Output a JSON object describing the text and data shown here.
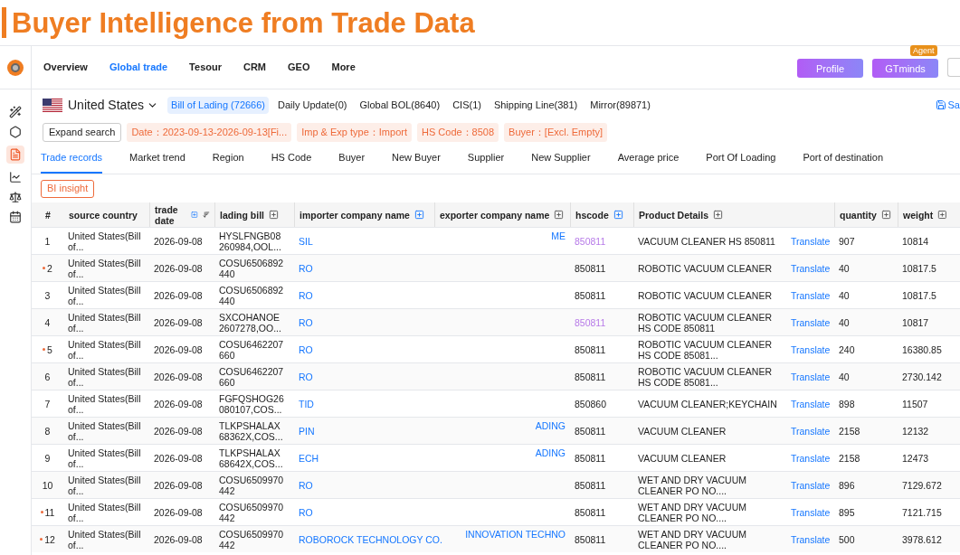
{
  "banner": {
    "title": "Buyer Intelligence from Trade Data"
  },
  "nav": {
    "items": [
      {
        "label": "Overview",
        "selected": false
      },
      {
        "label": "Global trade",
        "selected": true
      },
      {
        "label": "Tesour",
        "selected": false
      },
      {
        "label": "CRM",
        "selected": false
      },
      {
        "label": "GEO",
        "selected": false
      },
      {
        "label": "More",
        "selected": false
      }
    ],
    "buttons": [
      {
        "label": "Profile"
      },
      {
        "label": "GTminds",
        "badge": "Agent"
      }
    ]
  },
  "country": "United States",
  "sources": [
    {
      "label": "Bill of Lading (72666)",
      "selected": true
    },
    {
      "label": "Daily Update(0)",
      "selected": false
    },
    {
      "label": "Global BOL(8640)",
      "selected": false
    },
    {
      "label": "CIS(1)",
      "selected": false
    },
    {
      "label": "Shipping Line(381)",
      "selected": false
    },
    {
      "label": "Mirror(89871)",
      "selected": false
    }
  ],
  "save_link": "Sa",
  "expand_search": "Expand search",
  "filters": [
    "Date：2023-09-13-2026-09-13[Fi...",
    "Imp & Exp type：Import",
    "HS Code：8508",
    "Buyer：[Excl. Empty]"
  ],
  "tabs": [
    {
      "label": "Trade records",
      "selected": true
    },
    {
      "label": "Market trend",
      "selected": false
    },
    {
      "label": "Region",
      "selected": false
    },
    {
      "label": "HS Code",
      "selected": false
    },
    {
      "label": "Buyer",
      "selected": false
    },
    {
      "label": "New Buyer",
      "selected": false
    },
    {
      "label": "Supplier",
      "selected": false
    },
    {
      "label": "New Supplier",
      "selected": false
    },
    {
      "label": "Average price",
      "selected": false
    },
    {
      "label": "Port Of Loading",
      "selected": false
    },
    {
      "label": "Port of destination",
      "selected": false
    }
  ],
  "bi_insight": "BI insight",
  "table": {
    "columns": [
      "#",
      "source country",
      "trade date",
      "lading bill",
      "importer company name",
      "exporter company name",
      "hscode",
      "Product Details",
      "quantity",
      "weight"
    ],
    "rows": [
      {
        "no": "1",
        "marked": false,
        "country": "United States(Bill of...",
        "date": "2026-09-08",
        "bill": "HYSLFNGB08 260984,OOL...",
        "importer": "SIL",
        "exporter": "ME",
        "hscode": "850811",
        "visited": true,
        "product": "VACUUM CLEANER HS 850811",
        "translate": "Translate",
        "quantity": "907",
        "weight": "10814"
      },
      {
        "no": "2",
        "marked": true,
        "country": "United States(Bill of...",
        "date": "2026-09-08",
        "bill": "COSU6506892 440",
        "importer": "RO",
        "hscode": "850811",
        "visited": false,
        "product": "ROBOTIC VACUUM CLEANER",
        "translate": "Translate",
        "quantity": "40",
        "weight": "10817.5"
      },
      {
        "no": "3",
        "marked": false,
        "country": "United States(Bill of...",
        "date": "2026-09-08",
        "bill": "COSU6506892 440",
        "importer": "RO",
        "hscode": "850811",
        "visited": false,
        "product": "ROBOTIC VACUUM CLEANER",
        "translate": "Translate",
        "quantity": "40",
        "weight": "10817.5"
      },
      {
        "no": "4",
        "marked": false,
        "country": "United States(Bill of...",
        "date": "2026-09-08",
        "bill": "SXCOHANOE 2607278,OO...",
        "importer": "RO",
        "hscode": "850811",
        "visited": true,
        "product": "ROBOTIC VACUUM CLEANER HS CODE 850811",
        "translate": "Translate",
        "quantity": "40",
        "weight": "10817"
      },
      {
        "no": "5",
        "marked": true,
        "country": "United States(Bill of...",
        "date": "2026-09-08",
        "bill": "COSU6462207 660",
        "importer": "RO",
        "hscode": "850811",
        "visited": false,
        "product": "ROBOTIC VACUUM CLEANER HS CODE 85081...",
        "translate": "Translate",
        "quantity": "240",
        "weight": "16380.85"
      },
      {
        "no": "6",
        "marked": false,
        "country": "United States(Bill of...",
        "date": "2026-09-08",
        "bill": "COSU6462207 660",
        "importer": "RO",
        "hscode": "850811",
        "visited": false,
        "product": "ROBOTIC VACUUM CLEANER HS CODE 85081...",
        "translate": "Translate",
        "quantity": "40",
        "weight": "2730.142"
      },
      {
        "no": "7",
        "marked": false,
        "country": "United States(Bill of...",
        "date": "2026-09-08",
        "bill": "FGFQSHOG26 080107,COS...",
        "importer": "TID",
        "hscode": "850860",
        "visited": false,
        "product": "VACUUM CLEANER;KEYCHAIN",
        "translate": "Translate",
        "quantity": "898",
        "weight": "11507"
      },
      {
        "no": "8",
        "marked": false,
        "country": "United States(Bill of...",
        "date": "2026-09-08",
        "bill": "TLKPSHALAX 68362X,COS...",
        "importer": "PIN",
        "exporter": "ADING",
        "hscode": "850811",
        "visited": false,
        "product": "VACUUM CLEANER",
        "translate": "Translate",
        "quantity": "2158",
        "weight": "12132"
      },
      {
        "no": "9",
        "marked": false,
        "country": "United States(Bill of...",
        "date": "2026-09-08",
        "bill": "TLKPSHALAX 68642X,COS...",
        "importer": "ECH",
        "exporter": "ADING",
        "hscode": "850811",
        "visited": false,
        "product": "VACUUM CLEANER",
        "translate": "Translate",
        "quantity": "2158",
        "weight": "12473"
      },
      {
        "no": "10",
        "marked": false,
        "country": "United States(Bill of...",
        "date": "2026-09-08",
        "bill": "COSU6509970 442",
        "importer": "RO",
        "hscode": "850811",
        "visited": false,
        "product": "WET AND DRY VACUUM CLEANER PO NO....",
        "translate": "Translate",
        "quantity": "896",
        "weight": "7129.672"
      },
      {
        "no": "11",
        "marked": true,
        "country": "United States(Bill of...",
        "date": "2026-09-08",
        "bill": "COSU6509970 442",
        "importer": "RO",
        "hscode": "850811",
        "visited": false,
        "product": "WET AND DRY VACUUM CLEANER PO NO....",
        "translate": "Translate",
        "quantity": "895",
        "weight": "7121.715"
      },
      {
        "no": "12",
        "marked": true,
        "country": "United States(Bill of...",
        "date": "2026-09-08",
        "bill": "COSU6509970 442",
        "importer": "ROBOROCK TECHNOLOGY CO.",
        "exporter": "INNOVATION TECHNO",
        "hscode": "850811",
        "visited": false,
        "product": "WET AND DRY VACUUM CLEANER PO NO....",
        "translate": "Translate",
        "quantity": "500",
        "weight": "3978.612"
      }
    ]
  }
}
